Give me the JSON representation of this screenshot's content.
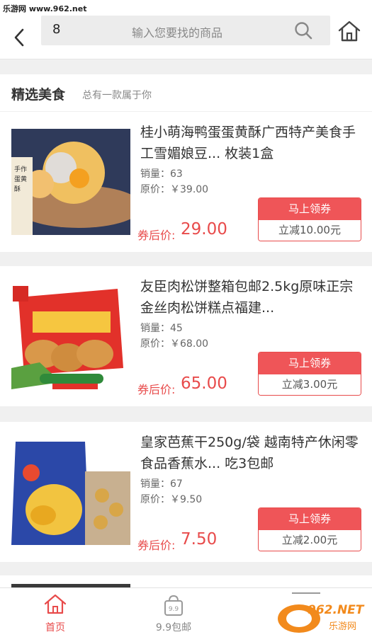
{
  "watermark_top": "乐游网 www.962.net",
  "search": {
    "query": "8",
    "placeholder": "输入您要找的商品"
  },
  "section": {
    "title": "精选美食",
    "subtitle": "总有一款属于你"
  },
  "products": [
    {
      "name": "桂小萌海鸭蛋蛋黄酥广西特产美食手工雪媚娘豆... 枚装1盒",
      "sales": "销量：63",
      "original": "原价：￥39.00",
      "after_label": "券后价:",
      "after_price": "29.00",
      "coupon_title": "马上领券",
      "coupon_value": "立减10.00元"
    },
    {
      "name": "友臣肉松饼整箱包邮2.5kg原味正宗金丝肉松饼糕点福建...",
      "sales": "销量：45",
      "original": "原价：￥68.00",
      "after_label": "券后价:",
      "after_price": "65.00",
      "coupon_title": "马上领券",
      "coupon_value": "立减3.00元"
    },
    {
      "name": "皇家芭蕉干250g/袋 越南特产休闲零食品香蕉水... 吃3包邮",
      "sales": "销量：67",
      "original": "原价：￥9.50",
      "after_label": "券后价:",
      "after_price": "7.50",
      "coupon_title": "马上领券",
      "coupon_value": "立减2.00元"
    }
  ],
  "tabs": [
    {
      "label": "首页",
      "icon": "home-icon",
      "active": true
    },
    {
      "label": "9.9包邮",
      "icon": "bag-icon",
      "active": false
    }
  ],
  "watermark_bottom": {
    "logo": "962.NET",
    "text": "乐游网"
  },
  "colors": {
    "accent": "#e84b4b",
    "coupon_fill": "#ef5558"
  }
}
